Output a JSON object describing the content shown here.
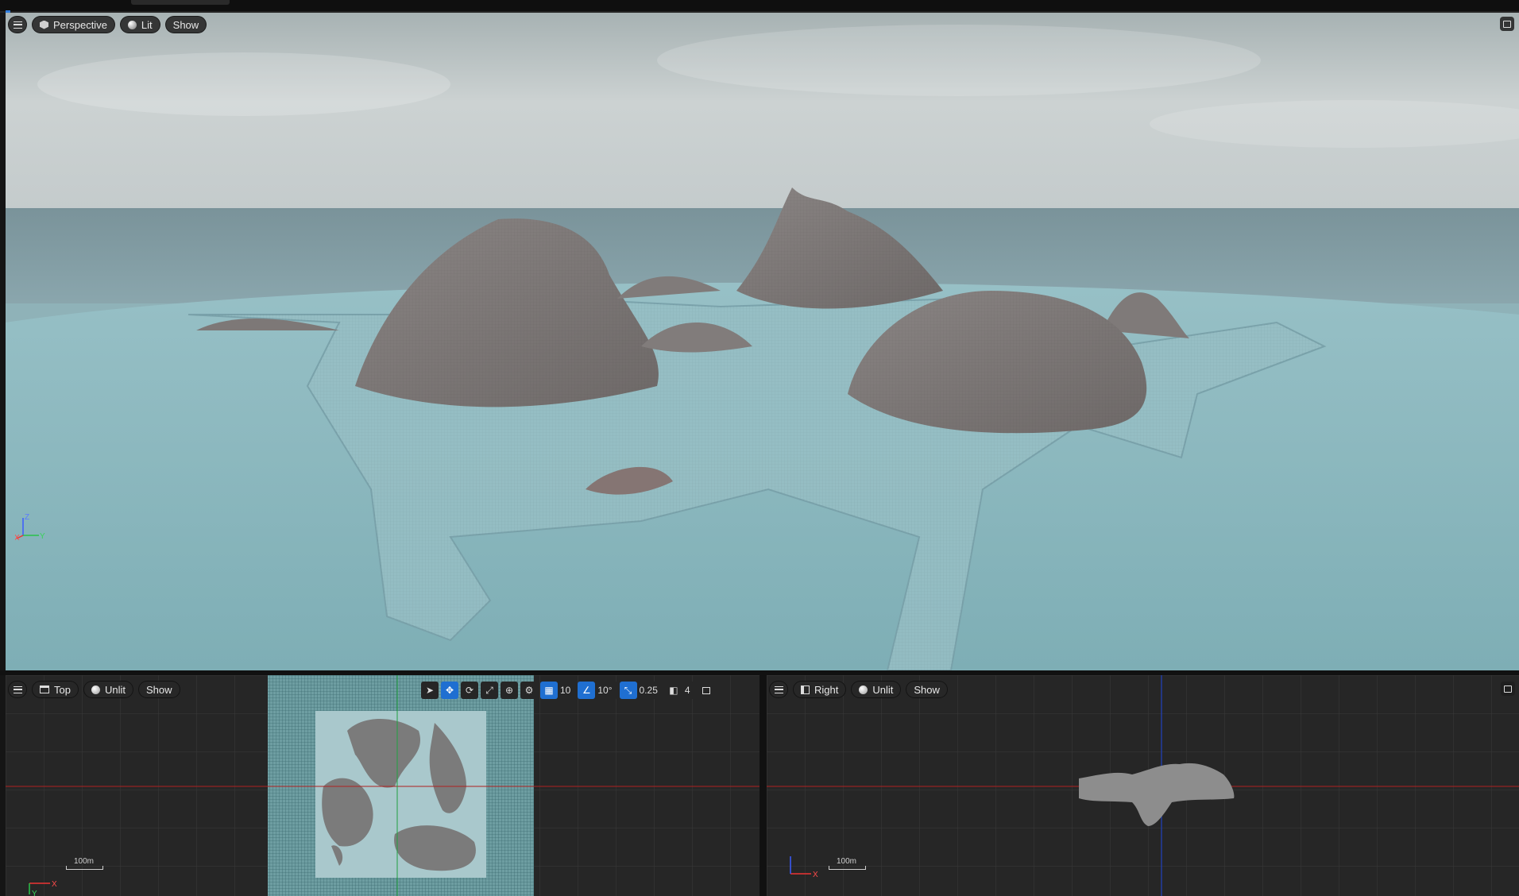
{
  "perspective_viewport": {
    "menu_icon": "hamburger-icon",
    "view_mode": "Perspective",
    "lighting_mode": "Lit",
    "show_label": "Show",
    "axis": {
      "z": "Z",
      "x": "X",
      "y": "Y"
    }
  },
  "top_viewport": {
    "view_mode": "Top",
    "lighting_mode": "Unlit",
    "show_label": "Show",
    "scale_label": "100m",
    "axis": {
      "x": "X",
      "y": "Y"
    },
    "tools": {
      "grid_snap_value": "10",
      "rotation_snap_value": "10°",
      "scale_snap_value": "0.25",
      "camera_speed_value": "4"
    }
  },
  "right_viewport": {
    "view_mode": "Right",
    "lighting_mode": "Unlit",
    "show_label": "Show",
    "scale_label": "100m",
    "axis": {
      "x": "X"
    }
  },
  "colors": {
    "sky": "#c8cfd0",
    "water": "#8fb8be",
    "terrain": "#7f7a78",
    "accent_active": "#1f6fd1",
    "grid_bg": "#262626",
    "x_axis_line": "#b02020",
    "y_axis_line": "#20a040",
    "z_axis_line": "#2040c0"
  }
}
